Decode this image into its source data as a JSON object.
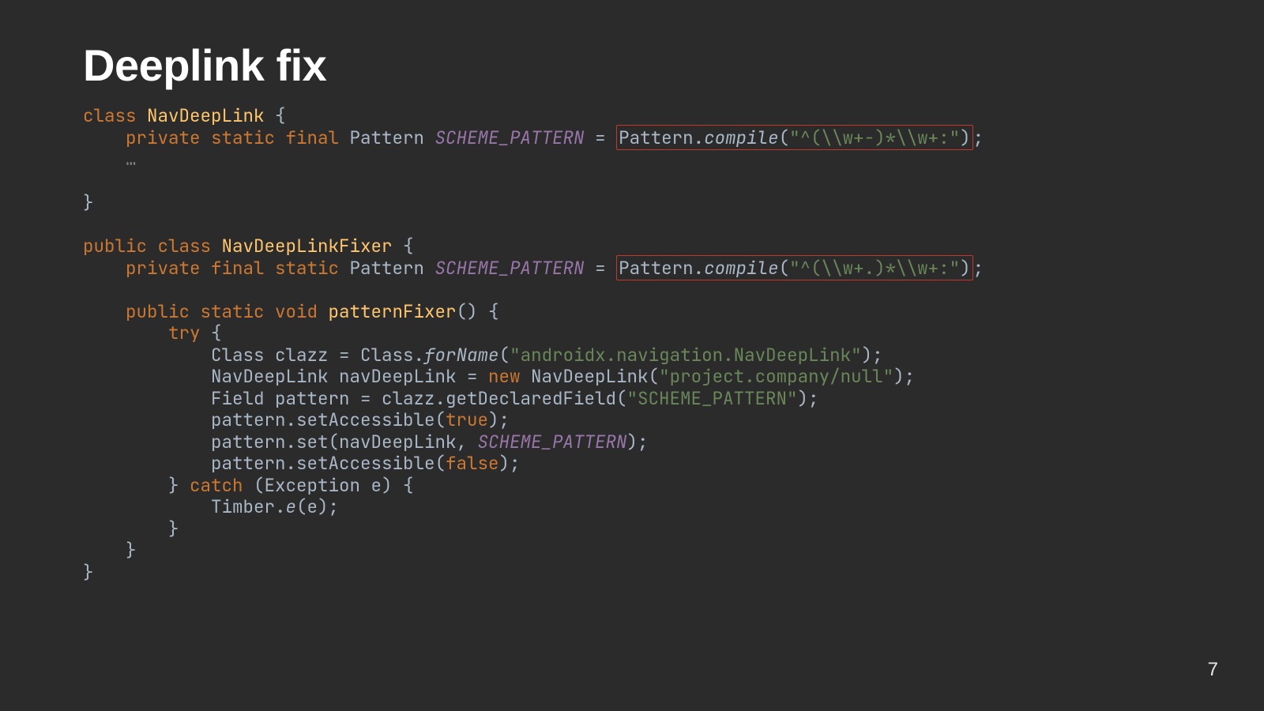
{
  "title": "Deeplink fix",
  "pageNumber": "7",
  "code": {
    "l1": {
      "kw1": "class",
      "name": "NavDeepLink",
      "brace": " {"
    },
    "l2": {
      "kw": "private static final",
      "type": " Pattern ",
      "field": "SCHEME_PATTERN",
      "eq": " = ",
      "boxA": "Pattern.",
      "boxB": "compile",
      "boxC": "(",
      "boxStr": "\"^(\\\\w+-)*\\\\w+:\"",
      "boxD": ")",
      "semi": ";"
    },
    "l3": {
      "ellipsis": "…"
    },
    "l4": {
      "brace": "}"
    },
    "l6": {
      "kw1": "public class",
      "name": " NavDeepLinkFixer",
      "brace": " {"
    },
    "l7": {
      "kw": "private final static",
      "type": " Pattern ",
      "field": "SCHEME_PATTERN",
      "eq": " = ",
      "boxA": "Pattern.",
      "boxB": "compile",
      "boxC": "(",
      "boxStr": "\"^(\\\\w+.)*\\\\w+:\"",
      "boxD": ")",
      "semi": ";"
    },
    "l9": {
      "kw": "public static void",
      "name": " patternFixer",
      "paren": "() {"
    },
    "l10": {
      "kw": "try",
      "brace": " {"
    },
    "l11": {
      "a": "Class clazz = Class.",
      "b": "forName",
      "c": "(",
      "s": "\"androidx.navigation.NavDeepLink\"",
      "d": ");"
    },
    "l12": {
      "a": "NavDeepLink navDeepLink = ",
      "kw": "new",
      "b": " NavDeepLink(",
      "s": "\"project.company/null\"",
      "d": ");"
    },
    "l13": {
      "a": "Field pattern = clazz.getDeclaredField(",
      "s": "\"SCHEME_PATTERN\"",
      "d": ");"
    },
    "l14": {
      "a": "pattern.setAccessible(",
      "kw": "true",
      "d": ");"
    },
    "l15": {
      "a": "pattern.set(navDeepLink, ",
      "field": "SCHEME_PATTERN",
      "d": ");"
    },
    "l16": {
      "a": "pattern.setAccessible(",
      "kw": "false",
      "d": ");"
    },
    "l17": {
      "a": "} ",
      "kw": "catch",
      "b": " (Exception e) {"
    },
    "l18": {
      "a": "Timber.",
      "b": "e",
      "c": "(e);"
    },
    "l19": {
      "a": "}"
    },
    "l20": {
      "a": "}"
    },
    "l21": {
      "a": "}"
    }
  }
}
